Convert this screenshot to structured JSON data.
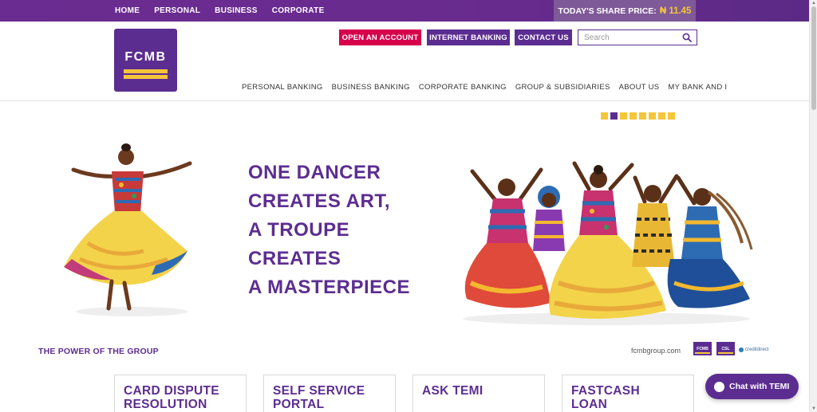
{
  "topbar": {
    "nav": [
      "HOME",
      "PERSONAL",
      "BUSINESS",
      "CORPORATE"
    ],
    "share_label": "TODAY'S SHARE PRICE:",
    "share_value": "₦ 11.45"
  },
  "logo": {
    "text": "FCMB"
  },
  "actions": {
    "open_account": "OPEN AN ACCOUNT",
    "internet_banking": "INTERNET BANKING",
    "contact_us": "CONTACT US"
  },
  "search": {
    "placeholder": "Search",
    "value": ""
  },
  "main_nav": [
    "PERSONAL BANKING",
    "BUSINESS BANKING",
    "CORPORATE BANKING",
    "GROUP & SUBSIDIARIES",
    "ABOUT US",
    "MY BANK AND I"
  ],
  "slider": {
    "total": 8,
    "active_index": 1
  },
  "hero": {
    "lines": [
      "ONE DANCER",
      "CREATES ART,",
      "A TROUPE",
      "CREATES",
      "A MASTERPIECE"
    ]
  },
  "footer_strip": {
    "tagline": "THE POWER OF THE GROUP",
    "site": "fcmbgroup.com",
    "mini_logos": [
      "FCMB",
      "CSL"
    ],
    "credit_direct": "creditdirect"
  },
  "cards": [
    {
      "title_l1": "CARD DISPUTE",
      "title_l2": "RESOLUTION"
    },
    {
      "title_l1": "SELF SERVICE",
      "title_l2": "PORTAL"
    },
    {
      "title_l1": "ASK TEMI",
      "title_l2": ""
    },
    {
      "title_l1": "FASTCASH",
      "title_l2": "LOAN"
    }
  ],
  "chat": {
    "label": "Chat with TEMI"
  },
  "colors": {
    "brand_purple": "#5c2d91",
    "brand_yellow": "#f5c63a",
    "accent_pink": "#d6004b"
  }
}
